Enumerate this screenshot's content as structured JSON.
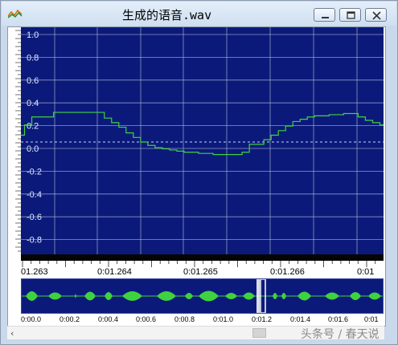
{
  "window": {
    "title": "生成的语音.wav",
    "controls": [
      "minimize-icon",
      "maximize-icon",
      "close-icon"
    ]
  },
  "colors": {
    "plot_bg": "#0b1a7a",
    "waveform": "#3fd23f",
    "grid": "#b8c0d8"
  },
  "chart_data": [
    {
      "type": "line",
      "ylim": [
        -1.0,
        1.0
      ],
      "y_ticks": [
        "1.0",
        "0.8",
        "0.6",
        "0.4",
        "0.2",
        "0.0",
        "-0.2",
        "-0.4",
        "-0.6",
        "-0.8"
      ],
      "x_ticks": [
        "01.263",
        "0:01.264",
        "0:01.265",
        "0:01.266",
        "0:01"
      ],
      "grid": true,
      "zero_line": "dashed",
      "series": [
        {
          "x": [
            0.0,
            0.01,
            0.03,
            0.09,
            0.21,
            0.23,
            0.25,
            0.27,
            0.29,
            0.31,
            0.33,
            0.35,
            0.37,
            0.39,
            0.41,
            0.43,
            0.45,
            0.49,
            0.53,
            0.57,
            0.61,
            0.63,
            0.67,
            0.69,
            0.71,
            0.73,
            0.75,
            0.77,
            0.79,
            0.81,
            0.85,
            0.89,
            0.93,
            0.95,
            0.97,
            0.99,
            1.0
          ],
          "values": [
            0.06,
            0.15,
            0.22,
            0.26,
            0.26,
            0.21,
            0.17,
            0.13,
            0.08,
            0.04,
            0.0,
            -0.03,
            -0.05,
            -0.06,
            -0.07,
            -0.08,
            -0.09,
            -0.1,
            -0.11,
            -0.11,
            -0.09,
            -0.02,
            0.02,
            0.06,
            0.1,
            0.14,
            0.18,
            0.2,
            0.22,
            0.23,
            0.24,
            0.25,
            0.22,
            0.19,
            0.17,
            0.15,
            0.15
          ]
        }
      ]
    },
    {
      "type": "area",
      "x_ticks": [
        "0:00.0",
        "0:00.2",
        "0:00.4",
        "0:00.6",
        "0:00.8",
        "0:01.0",
        "0:01.2",
        "0:01.4",
        "0:01.6",
        "0:01"
      ],
      "grid": false,
      "selection_marker": "0:01.2"
    }
  ],
  "scrollbar": {
    "left_arrow": "‹",
    "right_arrow": "›"
  },
  "watermark": "头条号 / 春天说"
}
